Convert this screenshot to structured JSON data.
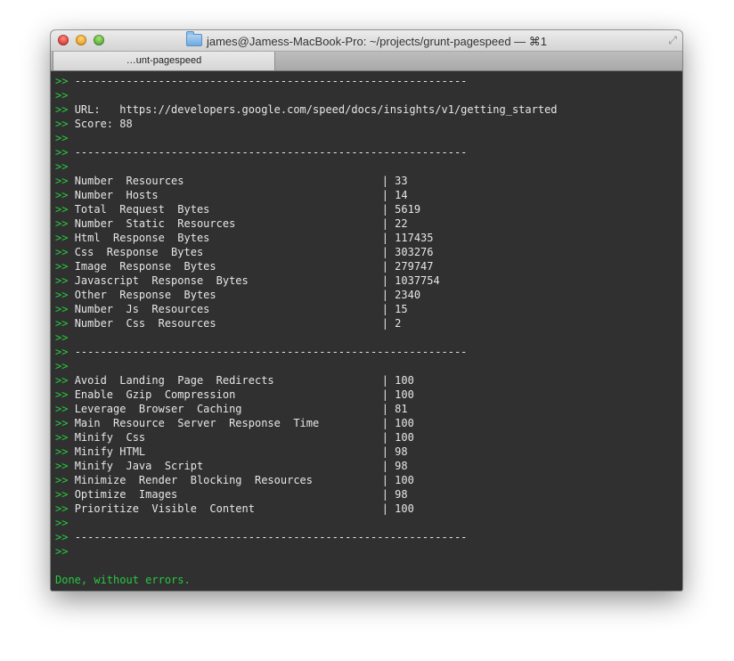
{
  "window": {
    "title": "james@Jamess-MacBook-Pro: ~/projects/grunt-pagespeed — ⌘1",
    "tab_label": "…unt-pagespeed"
  },
  "terminal": {
    "prompt": ">>",
    "separator": "-------------------------------------------------------------",
    "url_label": "URL:   https://developers.google.com/speed/docs/insights/v1/getting_started",
    "score_label": "Score: 88",
    "resources": [
      {
        "name": "Number  Resources",
        "value": "33"
      },
      {
        "name": "Number  Hosts",
        "value": "14"
      },
      {
        "name": "Total  Request  Bytes",
        "value": "5619"
      },
      {
        "name": "Number  Static  Resources",
        "value": "22"
      },
      {
        "name": "Html  Response  Bytes",
        "value": "117435"
      },
      {
        "name": "Css  Response  Bytes",
        "value": "303276"
      },
      {
        "name": "Image  Response  Bytes",
        "value": "279747"
      },
      {
        "name": "Javascript  Response  Bytes",
        "value": "1037754"
      },
      {
        "name": "Other  Response  Bytes",
        "value": "2340"
      },
      {
        "name": "Number  Js  Resources",
        "value": "15"
      },
      {
        "name": "Number  Css  Resources",
        "value": "2"
      }
    ],
    "rules": [
      {
        "name": "Avoid  Landing  Page  Redirects",
        "value": "100"
      },
      {
        "name": "Enable  Gzip  Compression",
        "value": "100"
      },
      {
        "name": "Leverage  Browser  Caching",
        "value": "81"
      },
      {
        "name": "Main  Resource  Server  Response  Time",
        "value": "100"
      },
      {
        "name": "Minify  Css",
        "value": "100"
      },
      {
        "name": "Minify HTML",
        "value": "98"
      },
      {
        "name": "Minify  Java  Script",
        "value": "98"
      },
      {
        "name": "Minimize  Render  Blocking  Resources",
        "value": "100"
      },
      {
        "name": "Optimize  Images",
        "value": "98"
      },
      {
        "name": "Prioritize  Visible  Content",
        "value": "100"
      }
    ],
    "column_divider": "|",
    "done_message": "Done, without errors."
  }
}
